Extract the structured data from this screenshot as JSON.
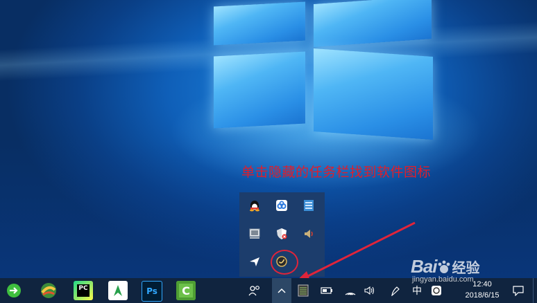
{
  "annotation": {
    "text": "单击隐藏的任务栏找到软件图标"
  },
  "tray_popup": {
    "icons": [
      {
        "name": "qq-icon",
        "glyph": "🐧",
        "bg": ""
      },
      {
        "name": "baidu-netdisk-icon",
        "glyph": "☁",
        "bg": "#ffffff"
      },
      {
        "name": "display-icon",
        "glyph": "▤",
        "bg": "#3b8ed6"
      },
      {
        "name": "storage-icon",
        "glyph": "▪",
        "bg": "#9aa6b2"
      },
      {
        "name": "security-shield-icon",
        "glyph": "✕",
        "bg": "#ffffff"
      },
      {
        "name": "volume-icon",
        "glyph": "◀",
        "bg": ""
      },
      {
        "name": "send-icon",
        "glyph": "➤",
        "bg": ""
      },
      {
        "name": "software-icon",
        "glyph": "◉",
        "bg": ""
      }
    ]
  },
  "taskbar": {
    "apps": [
      {
        "name": "green-arrow-app-icon",
        "glyph": "➜",
        "color": "#3fbf3f"
      },
      {
        "name": "paint-app-icon",
        "glyph": "◐",
        "color": "#e8a23a"
      },
      {
        "name": "pycharm-icon",
        "glyph": "PC",
        "color": "#2bb673"
      },
      {
        "name": "flag-app-icon",
        "glyph": "▲",
        "color": "#27a04b"
      },
      {
        "name": "photoshop-icon",
        "glyph": "Ps",
        "color": "#31a8ff"
      },
      {
        "name": "camtasia-icon",
        "glyph": "C",
        "color": "#6cc04a"
      }
    ],
    "overflow_glyph": "^",
    "people_glyph": "ꝏ",
    "system": [
      {
        "name": "cpu-meter-icon",
        "glyph": "▦"
      },
      {
        "name": "battery-icon",
        "glyph": "▭"
      },
      {
        "name": "wifi-icon",
        "glyph": "◔"
      },
      {
        "name": "speaker-icon",
        "glyph": "◁"
      },
      {
        "name": "pen-icon",
        "glyph": "✎"
      },
      {
        "name": "ime-icon",
        "glyph": "中"
      },
      {
        "name": "app-tray-icon",
        "glyph": "▣"
      }
    ],
    "clock_time": "12:40",
    "clock_date": "2018/6/15"
  },
  "watermark": {
    "logo": "Bai",
    "logo_suffix": "经验",
    "sub": "jingyan.baidu.com"
  }
}
